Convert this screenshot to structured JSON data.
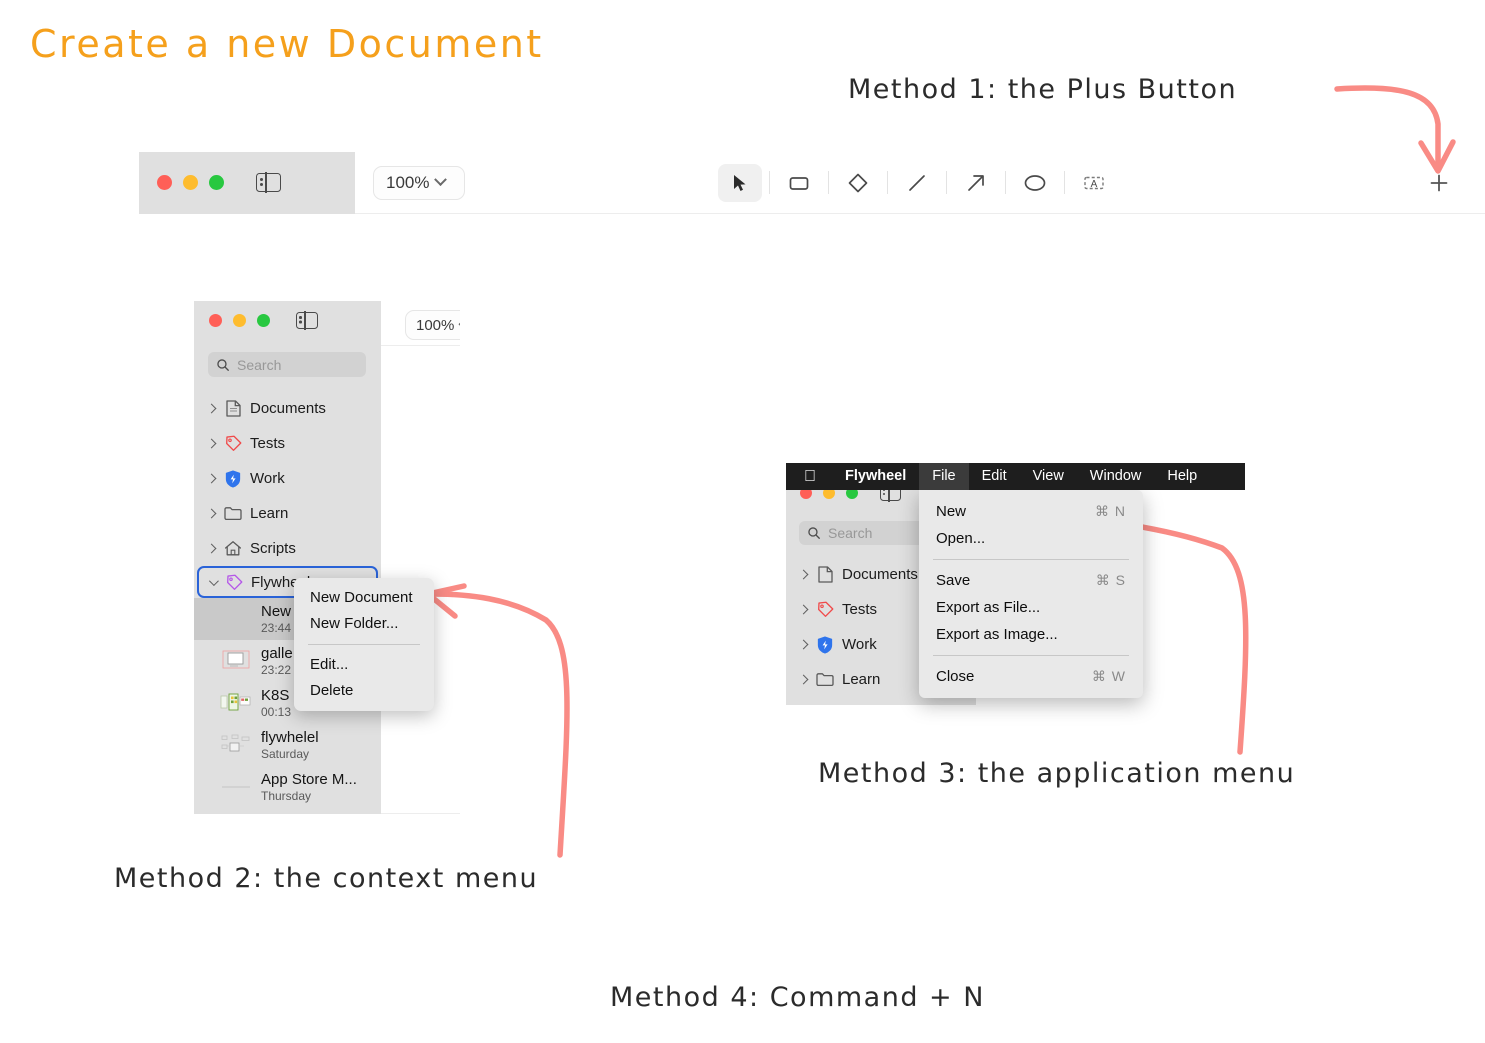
{
  "title": "Create a new Document",
  "annotations": {
    "method1": "Method 1: the Plus Button",
    "method2": "Method 2: the context menu",
    "method3": "Method 3: the application menu",
    "method4": "Method 4: Command + N"
  },
  "colors": {
    "title_orange": "#f5a01c",
    "arrow_red": "#f98b85",
    "selection_blue": "#2a63d8",
    "traffic_red": "#ff5f57",
    "traffic_yellow": "#febc2e",
    "traffic_green": "#28c840",
    "sidebar_bg": "#e0e0e0",
    "menu_bg": "#e9e9e9",
    "menubar_bg": "#1e1e1e"
  },
  "toolbar": {
    "zoom_value": "100%",
    "sidebar_toggle_icon": "sidebar-toggle-icon",
    "plus_icon": "plus-icon",
    "tools": [
      {
        "name": "cursor-tool",
        "icon": "cursor-icon",
        "active": true
      },
      {
        "name": "rectangle-tool",
        "icon": "rectangle-icon",
        "active": false
      },
      {
        "name": "diamond-tool",
        "icon": "diamond-icon",
        "active": false
      },
      {
        "name": "line-tool",
        "icon": "line-icon",
        "active": false
      },
      {
        "name": "arrow-tool",
        "icon": "arrow-icon",
        "active": false
      },
      {
        "name": "ellipse-tool",
        "icon": "ellipse-icon",
        "active": false
      },
      {
        "name": "text-tool",
        "icon": "text-box-icon",
        "active": false
      }
    ]
  },
  "sidebar": {
    "zoom_value": "100%",
    "search_placeholder": "Search",
    "search_icon": "search-icon",
    "tree": [
      {
        "label": "Documents",
        "icon": "document-icon",
        "expanded": false
      },
      {
        "label": "Tests",
        "icon": "tag-icon-red",
        "expanded": false
      },
      {
        "label": "Work",
        "icon": "shield-bolt-icon",
        "expanded": false
      },
      {
        "label": "Learn",
        "icon": "folder-icon",
        "expanded": false
      },
      {
        "label": "Scripts",
        "icon": "home-icon",
        "expanded": false
      },
      {
        "label": "Flywheel",
        "icon": "tag-icon-purple",
        "expanded": true,
        "selected": true
      }
    ],
    "files": [
      {
        "name": "New",
        "time": "23:44",
        "selected": true,
        "thumb": "none"
      },
      {
        "name": "galle",
        "time": "23:22",
        "selected": false,
        "thumb": "diagram"
      },
      {
        "name": "K8S",
        "time": "00:13",
        "selected": false,
        "thumb": "grid"
      },
      {
        "name": "flywhelel",
        "time": "Saturday",
        "selected": false,
        "thumb": "sketch"
      },
      {
        "name": "App Store M...",
        "time": "Thursday",
        "selected": false,
        "thumb": "line"
      }
    ]
  },
  "context_menu": {
    "items": [
      {
        "label": "New Document",
        "separator_after": false
      },
      {
        "label": "New Folder...",
        "separator_after": true
      },
      {
        "label": "Edit...",
        "separator_after": false
      },
      {
        "label": "Delete",
        "separator_after": false
      }
    ]
  },
  "app_window": {
    "search_placeholder": "Search",
    "tree": [
      {
        "label": "Documents",
        "icon": "document-icon"
      },
      {
        "label": "Tests",
        "icon": "tag-icon-red"
      },
      {
        "label": "Work",
        "icon": "shield-bolt-icon"
      },
      {
        "label": "Learn",
        "icon": "folder-icon"
      }
    ]
  },
  "menubar": {
    "apple_icon": "apple-logo-icon",
    "app_name": "Flywheel",
    "items": [
      {
        "label": "File",
        "active": true
      },
      {
        "label": "Edit",
        "active": false
      },
      {
        "label": "View",
        "active": false
      },
      {
        "label": "Window",
        "active": false
      },
      {
        "label": "Help",
        "active": false
      }
    ]
  },
  "file_menu": {
    "items": [
      {
        "label": "New",
        "shortcut": "⌘ N",
        "separator_after": false
      },
      {
        "label": "Open...",
        "shortcut": "",
        "separator_after": true
      },
      {
        "label": "Save",
        "shortcut": "⌘ S",
        "separator_after": false
      },
      {
        "label": "Export as File...",
        "shortcut": "",
        "separator_after": false
      },
      {
        "label": "Export as Image...",
        "shortcut": "",
        "separator_after": true
      },
      {
        "label": "Close",
        "shortcut": "⌘ W",
        "separator_after": false
      }
    ]
  }
}
